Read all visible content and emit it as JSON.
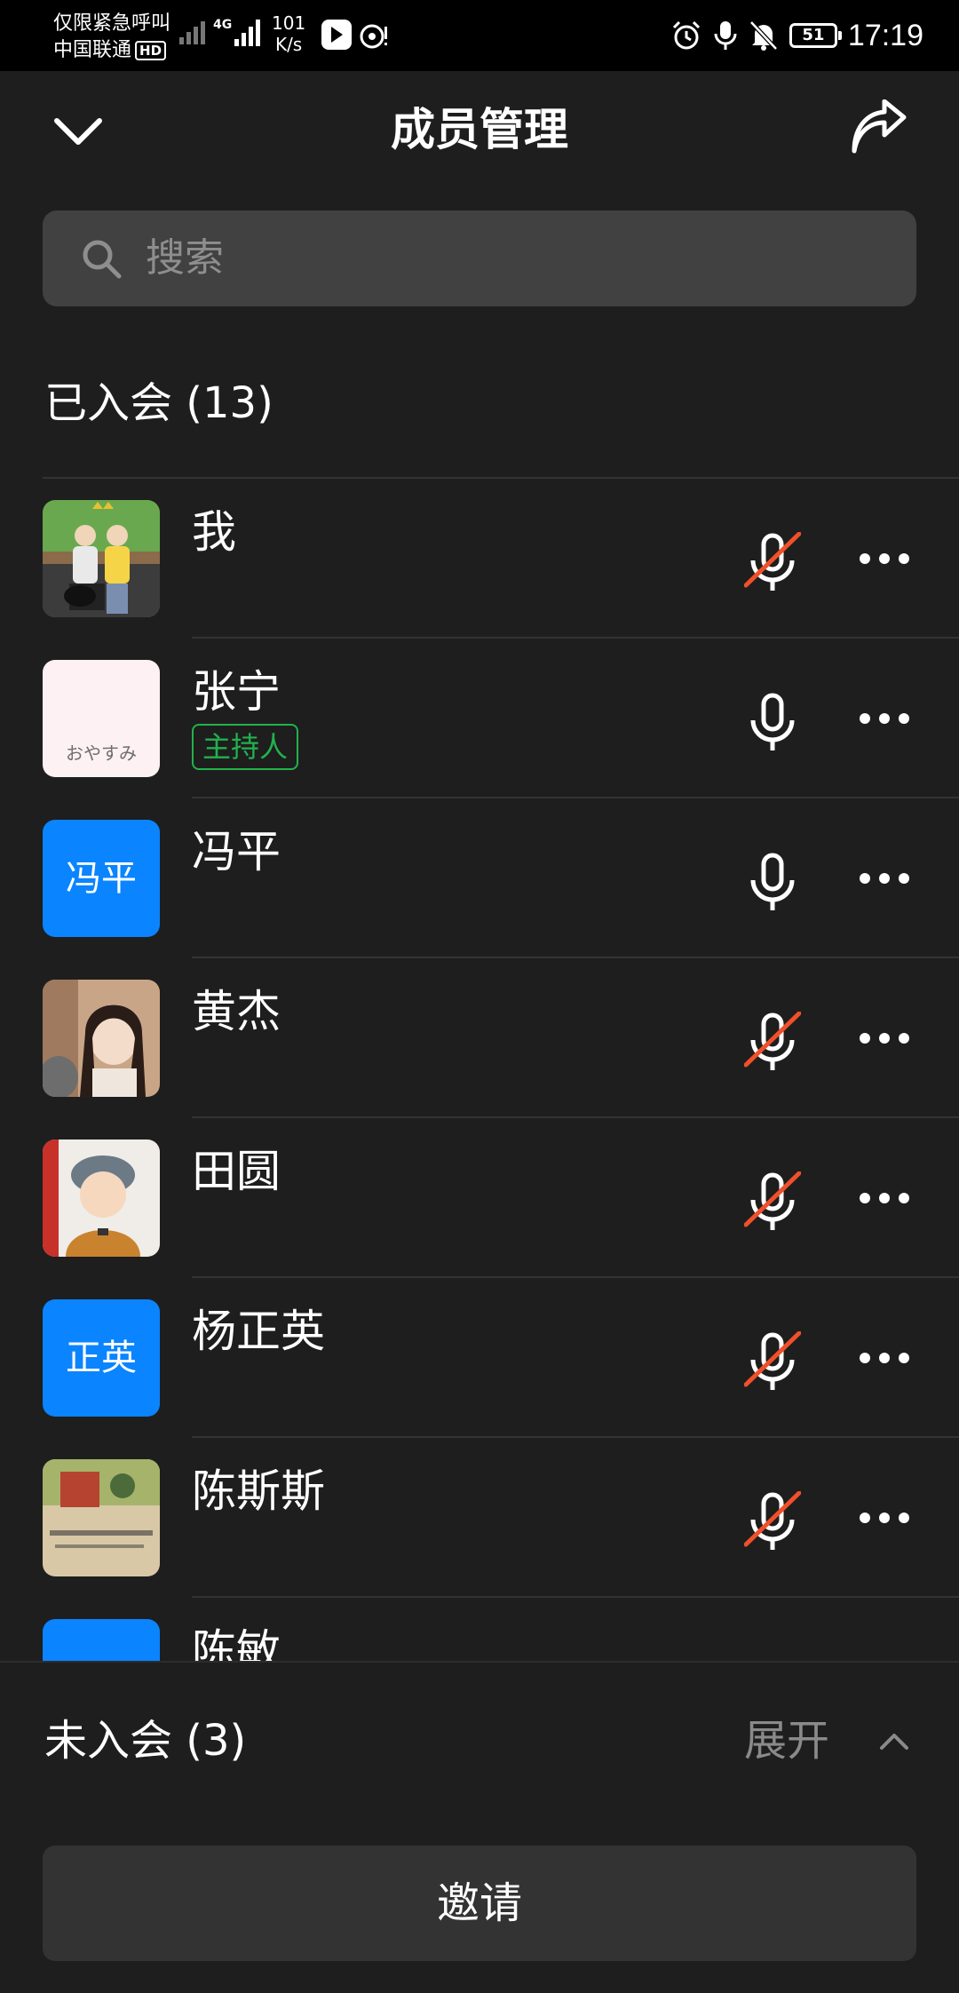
{
  "status_bar": {
    "emergency_text": "仅限紧急呼叫",
    "carrier": "中国联通",
    "hd": "HD",
    "network": "4G",
    "speed_value": "101",
    "speed_unit": "K/s",
    "battery": "51",
    "time": "17:19"
  },
  "header": {
    "title": "成员管理"
  },
  "search": {
    "placeholder": "搜索"
  },
  "joined": {
    "title": "已入会 (13)"
  },
  "members": [
    {
      "name": "我",
      "avatar": "photo",
      "muted": true
    },
    {
      "name": "张宁",
      "avatar": "photo-pink",
      "avatar_caption": "おやすみ",
      "badge": "主持人",
      "muted": false
    },
    {
      "name": "冯平",
      "avatar": "text",
      "avatar_text": "冯平",
      "muted": false
    },
    {
      "name": "黄杰",
      "avatar": "photo",
      "muted": true
    },
    {
      "name": "田圆",
      "avatar": "photo",
      "muted": true
    },
    {
      "name": "杨正英",
      "avatar": "text",
      "avatar_text": "正英",
      "muted": true
    },
    {
      "name": "陈斯斯",
      "avatar": "photo",
      "muted": true
    },
    {
      "name": "陈敏",
      "avatar": "text",
      "muted": null
    }
  ],
  "not_joined": {
    "title": "未入会 (3)",
    "expand_label": "展开"
  },
  "invite_button": "邀请",
  "colors": {
    "background": "#1e1e1e",
    "accent_blue": "#0a84ff",
    "host_green": "#22b14c",
    "muted_red": "#f0502a"
  }
}
